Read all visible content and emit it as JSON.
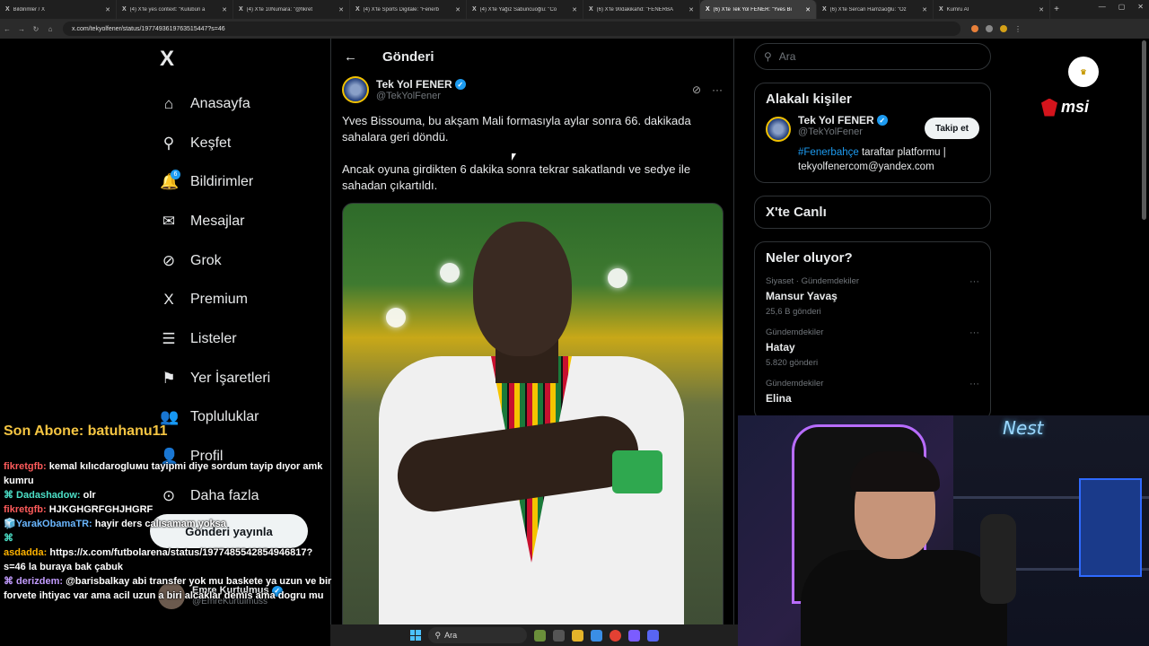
{
  "browser": {
    "tabs": [
      {
        "label": "Bildirimler / X",
        "active": false
      },
      {
        "label": "(4) X'te yes context: \"Kulübün a",
        "active": false
      },
      {
        "label": "(4) X'te 10Numara: \"@fikret",
        "active": false
      },
      {
        "label": "(4) X'te Sports Digitale: \"Fenerb",
        "active": false
      },
      {
        "label": "(4) X'te Yağız Sabuncuoğlu: \"Co",
        "active": false
      },
      {
        "label": "(6) X'te 90dakikahd: \"FENERBA",
        "active": false
      },
      {
        "label": "(6) X'te Tek Yol FENER: \"Yves Bi",
        "active": true
      },
      {
        "label": "(6) X'te Sercan Hamzaoğlu: \"Oz",
        "active": false
      },
      {
        "label": "Kumru AI",
        "active": false
      }
    ],
    "url": "x.com/tekyolfener/status/1977493619763515447?s=46"
  },
  "nav": {
    "logo": "X",
    "items": [
      {
        "label": "Anasayfa",
        "icon": "home-icon",
        "glyph": "⌂"
      },
      {
        "label": "Keşfet",
        "icon": "search-icon",
        "glyph": "⚲"
      },
      {
        "label": "Bildirimler",
        "icon": "bell-icon",
        "glyph": "🔔",
        "badge": "6"
      },
      {
        "label": "Mesajlar",
        "icon": "mail-icon",
        "glyph": "✉"
      },
      {
        "label": "Grok",
        "icon": "grok-icon",
        "glyph": "⊘"
      },
      {
        "label": "Premium",
        "icon": "x-premium-icon",
        "glyph": "X"
      },
      {
        "label": "Listeler",
        "icon": "list-icon",
        "glyph": "☰"
      },
      {
        "label": "Yer İşaretleri",
        "icon": "bookmark-icon",
        "glyph": "⚑"
      },
      {
        "label": "Topluluklar",
        "icon": "communities-icon",
        "glyph": "👥"
      },
      {
        "label": "Profil",
        "icon": "profile-icon",
        "glyph": "👤"
      },
      {
        "label": "Daha fazla",
        "icon": "more-circle-icon",
        "glyph": "⊙"
      }
    ],
    "post_button": "Gönderi yayınla",
    "account": {
      "name": "Emre Kurtulmuş",
      "handle": "@EmreKurtulmuss"
    }
  },
  "post": {
    "header": "Gönderi",
    "author_name": "Tek Yol FENER",
    "author_handle": "@TekYolFener",
    "text_1": "Yves Bissouma, bu akşam Mali formasıyla aylar sonra 66. dakikada sahalara geri döndü.",
    "text_2": "Ancak oyuna girdikten 6 dakika sonra tekrar sakatlandı ve sedye ile sahadan çıkartıldı."
  },
  "sidebar": {
    "search_placeholder": "Ara",
    "related_title": "Alakalı kişiler",
    "related": {
      "name": "Tek Yol FENER",
      "handle": "@TekYolFener",
      "follow": "Takip et",
      "bio_tag": "#Fenerbahçe",
      "bio_rest": " taraftar platformu | tekyolfenercom@yandex.com"
    },
    "live_title": "X'te Canlı",
    "trends_title": "Neler oluyor?",
    "trends": [
      {
        "meta": "Siyaset · Gündemdekiler",
        "name": "Mansur Yavaş",
        "count": "25,6 B gönderi"
      },
      {
        "meta": "Gündemdekiler",
        "name": "Hatay",
        "count": "5.820 gönderi"
      },
      {
        "meta": "Gündemdekiler",
        "name": "Elina",
        "count": ""
      }
    ]
  },
  "overlay": {
    "sub_text": "Son Abone: batuhanu11",
    "brand": "msi",
    "chat": [
      {
        "user": "fikretgfb:",
        "msg": " kemal kılıcdarogluмu tayipmi diye sordum tayip dıyor amk kumru",
        "cls": "u1"
      },
      {
        "user": "⌘ Dadashadow:",
        "msg": " olr",
        "cls": "u2"
      },
      {
        "user": "fikretgfb:",
        "msg": " HJKGHGRFGHJHGRF",
        "cls": "u1"
      },
      {
        "user": "🧊YarakObamaTR:",
        "msg": " hayir ders calısamam yoksa",
        "cls": "u3"
      },
      {
        "user": "⌘",
        "msg": "",
        "cls": "u2"
      },
      {
        "user": "asdadda:",
        "msg": " https://x.com/futbolarena/status/1977485542854946817?s=46 la buraya bak çabuk",
        "cls": "u4"
      },
      {
        "user": "⌘ derizdem:",
        "msg": " @barisbalkay abi transfer yok mu baskete ya uzun ve bir forvete ihtiyac var ama acil uzun a biri alcaklar demis ama dogru mu",
        "cls": "u5"
      }
    ],
    "cam_sign": "Nest"
  },
  "taskbar": {
    "search": "Ara"
  }
}
